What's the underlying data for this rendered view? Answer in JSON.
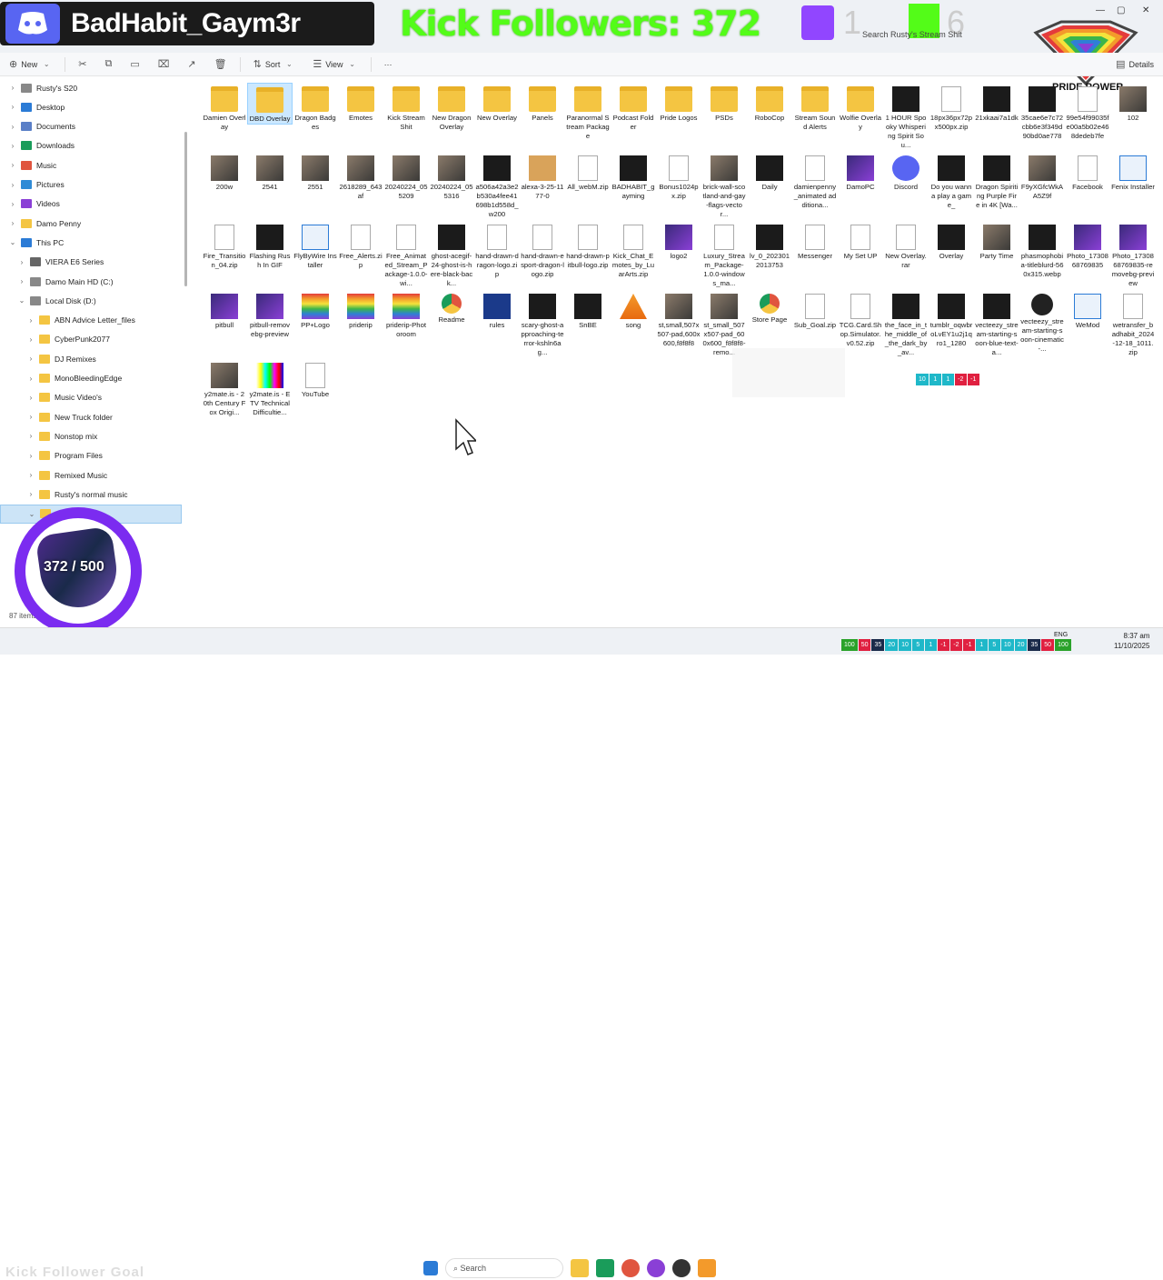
{
  "overlay": {
    "discord_name": "BadHabit_Gaym3r",
    "kick_followers": "Kick Followers: 372",
    "twitch_count": "1",
    "kick_count": "6",
    "pride_label": "PRIDE POWER",
    "goal_progress": "372 / 500",
    "goal_title": "Kick Follower Goal",
    "colors": {
      "kick": "#53fc18",
      "discord": "#5865f2",
      "twitch": "#9146ff",
      "goal_ring": "#7b2cf0"
    }
  },
  "search": {
    "placeholder": "Search Rusty's Stream Shit"
  },
  "command_bar": {
    "new": "New",
    "sort": "Sort",
    "view": "View",
    "more": "···",
    "details": "Details"
  },
  "sidebar": [
    {
      "label": "Rusty's S20",
      "icon": "user-folder-icon",
      "depth": 0,
      "color": "#888"
    },
    {
      "label": "Desktop",
      "icon": "desktop-icon",
      "depth": 0,
      "color": "#2b7bd6"
    },
    {
      "label": "Documents",
      "icon": "documents-icon",
      "depth": 0,
      "color": "#5a7fc7"
    },
    {
      "label": "Downloads",
      "icon": "downloads-icon",
      "depth": 0,
      "color": "#1a9c5a"
    },
    {
      "label": "Music",
      "icon": "music-icon",
      "depth": 0,
      "color": "#e0553f"
    },
    {
      "label": "Pictures",
      "icon": "pictures-icon",
      "depth": 0,
      "color": "#2f8bd6"
    },
    {
      "label": "Videos",
      "icon": "videos-icon",
      "depth": 0,
      "color": "#8a3fd6"
    },
    {
      "label": "Damo Penny",
      "icon": "folder-icon",
      "depth": 0,
      "color": "#f4c542"
    },
    {
      "label": "This PC",
      "icon": "pc-icon",
      "depth": 0,
      "color": "#2b7bd6",
      "open": true
    },
    {
      "label": "VIERA E6 Series",
      "icon": "device-icon",
      "depth": 1,
      "color": "#666"
    },
    {
      "label": "Damo Main HD (C:)",
      "icon": "drive-icon",
      "depth": 1,
      "color": "#888"
    },
    {
      "label": "Local Disk (D:)",
      "icon": "drive-icon",
      "depth": 1,
      "color": "#888",
      "open": true
    },
    {
      "label": "ABN Advice Letter_files",
      "icon": "folder-icon",
      "depth": 2,
      "color": "#f4c542"
    },
    {
      "label": "CyberPunk2077",
      "icon": "folder-icon",
      "depth": 2,
      "color": "#f4c542"
    },
    {
      "label": "DJ Remixes",
      "icon": "folder-icon",
      "depth": 2,
      "color": "#f4c542"
    },
    {
      "label": "MonoBleedingEdge",
      "icon": "folder-icon",
      "depth": 2,
      "color": "#f4c542"
    },
    {
      "label": "Music Video's",
      "icon": "folder-icon",
      "depth": 2,
      "color": "#f4c542"
    },
    {
      "label": "New Truck  folder",
      "icon": "folder-icon",
      "depth": 2,
      "color": "#f4c542"
    },
    {
      "label": "Nonstop mix",
      "icon": "folder-icon",
      "depth": 2,
      "color": "#f4c542"
    },
    {
      "label": "Program Files",
      "icon": "folder-icon",
      "depth": 2,
      "color": "#f4c542"
    },
    {
      "label": "Remixed Music",
      "icon": "folder-icon",
      "depth": 2,
      "color": "#f4c542"
    },
    {
      "label": "Rusty's normal music",
      "icon": "folder-icon",
      "depth": 2,
      "color": "#f4c542"
    },
    {
      "label": "",
      "icon": "folder-icon",
      "depth": 2,
      "color": "#f4c542",
      "open": true,
      "selected": true
    },
    {
      "label": "Damien Overlay",
      "icon": "folder-icon",
      "depth": 3,
      "color": "#f4c542"
    }
  ],
  "files": [
    {
      "name": "Damien Overlay",
      "kind": "folder"
    },
    {
      "name": "DBD Overlay",
      "kind": "folder",
      "selected": true
    },
    {
      "name": "Dragon Badges",
      "kind": "folder"
    },
    {
      "name": "Emotes",
      "kind": "folder"
    },
    {
      "name": "Kick Stream Shit",
      "kind": "folder"
    },
    {
      "name": "New Dragon Overlay",
      "kind": "folder"
    },
    {
      "name": "New Overlay",
      "kind": "folder"
    },
    {
      "name": "Panels",
      "kind": "folder"
    },
    {
      "name": "Paranormal Stream Package",
      "kind": "folder"
    },
    {
      "name": "Podcast Folder",
      "kind": "folder"
    },
    {
      "name": "Pride Logos",
      "kind": "folder"
    },
    {
      "name": "PSDs",
      "kind": "folder"
    },
    {
      "name": "RoboCop",
      "kind": "folder"
    },
    {
      "name": "Stream Sound Alerts",
      "kind": "folder"
    },
    {
      "name": "Wolfie Overlay",
      "kind": "folder"
    },
    {
      "name": "1 HOUR Spooky Whispering Spirit Sou...",
      "kind": "dark"
    },
    {
      "name": "18px36px72px500px.zip",
      "kind": "doc"
    },
    {
      "name": "21xkaai7a1dk",
      "kind": "dark"
    },
    {
      "name": "35cae6e7c72cbb6e3f349d90bd0ae778",
      "kind": "dark"
    },
    {
      "name": "99e54f99035fe00a5b02e468dedeb7fe",
      "kind": "doc"
    },
    {
      "name": "102",
      "kind": "photo"
    },
    {
      "name": "200w",
      "kind": "photo"
    },
    {
      "name": "2541",
      "kind": "photo"
    },
    {
      "name": "2551",
      "kind": "photo"
    },
    {
      "name": "2618289_643af",
      "kind": "photo"
    },
    {
      "name": "20240224_055209",
      "kind": "photo"
    },
    {
      "name": "20240224_055316",
      "kind": "photo"
    },
    {
      "name": "a506a42a3e2b530a4fee41698b1d558d_w200",
      "kind": "dark"
    },
    {
      "name": "alexa-3-25-1177-0",
      "kind": "box"
    },
    {
      "name": "All_webM.zip",
      "kind": "doc"
    },
    {
      "name": "BADHABIT_gayming",
      "kind": "dark"
    },
    {
      "name": "Bonus1024px.zip",
      "kind": "doc"
    },
    {
      "name": "brick-wall-scotland-and-gay-flags-vector...",
      "kind": "photo"
    },
    {
      "name": "Daily",
      "kind": "dark"
    },
    {
      "name": "damienpenny_animated additiona...",
      "kind": "doc"
    },
    {
      "name": "DamoPC",
      "kind": "purple"
    },
    {
      "name": "Discord",
      "kind": "discord"
    },
    {
      "name": "Do you wanna play a game_",
      "kind": "dark"
    },
    {
      "name": "Dragon Spiriting Purple Fire in 4K [Wa...",
      "kind": "dark"
    },
    {
      "name": "F9yXGfcWkAA5Z9f",
      "kind": "photo"
    },
    {
      "name": "Facebook",
      "kind": "doc"
    },
    {
      "name": "Fenix Installer",
      "kind": "app"
    },
    {
      "name": "Fire_Transition_04.zip",
      "kind": "doc"
    },
    {
      "name": "Flashing Rush In GIF",
      "kind": "dark"
    },
    {
      "name": "FlyByWire Installer",
      "kind": "app"
    },
    {
      "name": "Free_Alerts.zip",
      "kind": "doc"
    },
    {
      "name": "Free_Animated_Stream_Package-1.0.0-wi...",
      "kind": "doc"
    },
    {
      "name": "ghost-acegif-24-ghost-is-here-black-back...",
      "kind": "dark"
    },
    {
      "name": "hand-drawn-dragon-logo.zip",
      "kind": "doc"
    },
    {
      "name": "hand-drawn-esport-dragon-logo.zip",
      "kind": "doc"
    },
    {
      "name": "hand-drawn-pitbull-logo.zip",
      "kind": "doc"
    },
    {
      "name": "Kick_Chat_Emotes_by_LuarArts.zip",
      "kind": "doc"
    },
    {
      "name": "logo2",
      "kind": "purple"
    },
    {
      "name": "Luxury_Stream_Package-1.0.0-windows_ma...",
      "kind": "doc"
    },
    {
      "name": "lv_0_2023012013753",
      "kind": "dark"
    },
    {
      "name": "Messenger",
      "kind": "doc"
    },
    {
      "name": "My Set UP",
      "kind": "doc"
    },
    {
      "name": "New Overlay.rar",
      "kind": "doc"
    },
    {
      "name": "Overlay",
      "kind": "dark"
    },
    {
      "name": "Party Time",
      "kind": "photo"
    },
    {
      "name": "phasmophobia-titleblurd-560x315.webp",
      "kind": "dark"
    },
    {
      "name": "Photo_1730868769835",
      "kind": "purple"
    },
    {
      "name": "Photo_1730868769835-removebg-preview",
      "kind": "purple"
    },
    {
      "name": "pitbull",
      "kind": "purple"
    },
    {
      "name": "pitbull-removebg-preview",
      "kind": "purple"
    },
    {
      "name": "PP+Logo",
      "kind": "rainbow"
    },
    {
      "name": "priderip",
      "kind": "rainbow"
    },
    {
      "name": "priderip-Photoroom",
      "kind": "rainbow"
    },
    {
      "name": "Readme",
      "kind": "chrome"
    },
    {
      "name": "rules",
      "kind": "blue"
    },
    {
      "name": "scary-ghost-approaching-terror-kshln6ag...",
      "kind": "dark"
    },
    {
      "name": "SnBE",
      "kind": "dark"
    },
    {
      "name": "song",
      "kind": "vlc"
    },
    {
      "name": "st,small,507x507-pad,600x600,f8f8f8",
      "kind": "photo"
    },
    {
      "name": "st_small_507x507-pad_600x600_f8f8f8-remo...",
      "kind": "photo"
    },
    {
      "name": "Store Page",
      "kind": "chrome"
    },
    {
      "name": "Sub_Goal.zip",
      "kind": "doc"
    },
    {
      "name": "TCG.Card.Shop.Simulator.v0.52.zip",
      "kind": "doc"
    },
    {
      "name": "the_face_in_the_middle_of_the_dark_by_av...",
      "kind": "dark"
    },
    {
      "name": "tumblr_oqwbroLvEY1u2j1qro1_1280",
      "kind": "dark"
    },
    {
      "name": "vecteezy_stream-starting-soon-blue-text-a...",
      "kind": "dark"
    },
    {
      "name": "vecteezy_stream-starting-soon-cinematic-...",
      "kind": "media"
    },
    {
      "name": "WeMod",
      "kind": "app"
    },
    {
      "name": "wetransfer_badhabit_2024-12-18_1011.zip",
      "kind": "doc"
    },
    {
      "name": "y2mate.is - 20th Century Fox Origi...",
      "kind": "photo"
    },
    {
      "name": "y2mate.is - ETV Technical Difficultie...",
      "kind": "bars"
    },
    {
      "name": "YouTube",
      "kind": "doc"
    }
  ],
  "status": {
    "item_count": "87 items",
    "selected": "selected"
  },
  "taskbar": {
    "search": "Search",
    "lang": "ENG",
    "time": "8:37 am",
    "date": "11/10/2025"
  },
  "stat_chips": [
    {
      "v": "10",
      "c": "#1fb8c9"
    },
    {
      "v": "1",
      "c": "#1fb8c9"
    },
    {
      "v": "1",
      "c": "#1fb8c9"
    },
    {
      "v": "-2",
      "c": "#e02040"
    },
    {
      "v": "-1",
      "c": "#e02040"
    }
  ],
  "stat_chips_bottom": [
    {
      "v": "100",
      "c": "#2aa22a"
    },
    {
      "v": "50",
      "c": "#e02040"
    },
    {
      "v": "35",
      "c": "#1a2a4a"
    },
    {
      "v": "20",
      "c": "#1fb8c9"
    },
    {
      "v": "10",
      "c": "#1fb8c9"
    },
    {
      "v": "5",
      "c": "#1fb8c9"
    },
    {
      "v": "1",
      "c": "#1fb8c9"
    },
    {
      "v": "-1",
      "c": "#e02040"
    },
    {
      "v": "-2",
      "c": "#e02040"
    },
    {
      "v": "-1",
      "c": "#e02040"
    },
    {
      "v": "1",
      "c": "#1fb8c9"
    },
    {
      "v": "5",
      "c": "#1fb8c9"
    },
    {
      "v": "10",
      "c": "#1fb8c9"
    },
    {
      "v": "20",
      "c": "#1fb8c9"
    },
    {
      "v": "35",
      "c": "#1a2a4a"
    },
    {
      "v": "50",
      "c": "#e02040"
    },
    {
      "v": "100",
      "c": "#2aa22a"
    }
  ]
}
